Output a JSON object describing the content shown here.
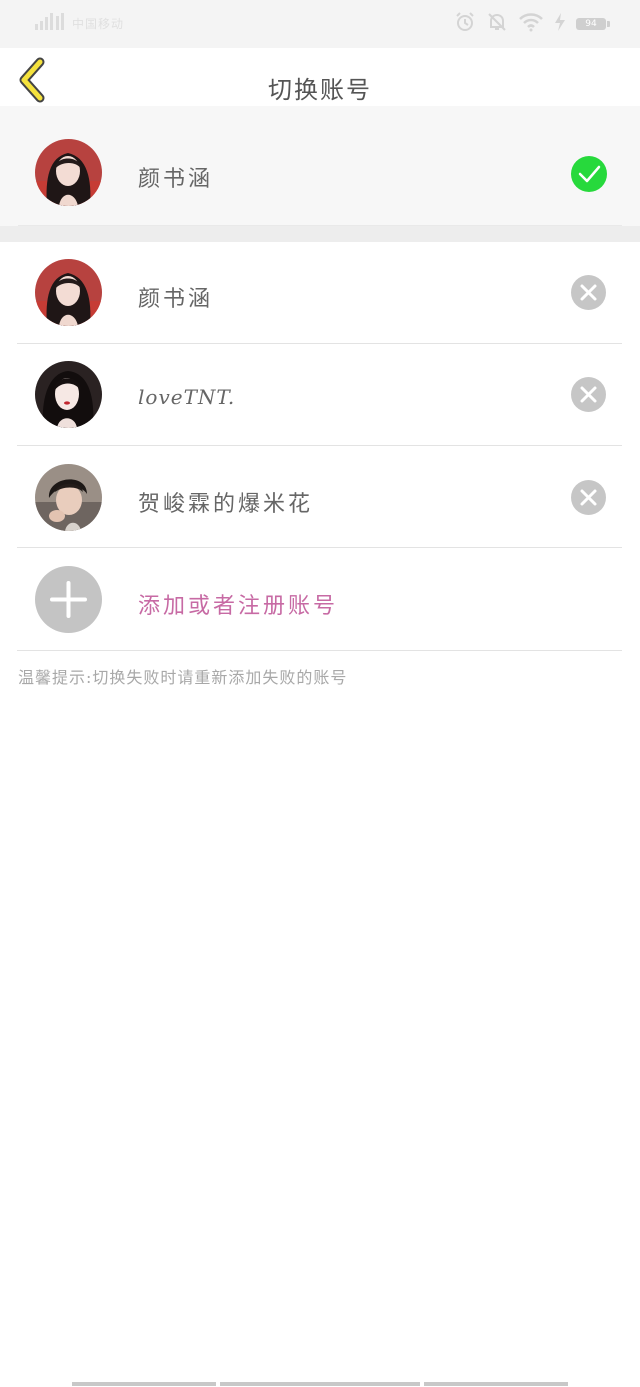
{
  "status_bar": {
    "carrier": "中国移动",
    "battery_level": "94",
    "icons": [
      "signal-icon",
      "alarm-icon",
      "mute-icon",
      "wifi-icon",
      "charging-icon",
      "battery-icon"
    ]
  },
  "header": {
    "title": "切换账号",
    "back_icon": "chevron-left-icon"
  },
  "current_account": {
    "name": "颜书涵",
    "status_icon": "check-circle-icon",
    "status_color": "#27d93c"
  },
  "accounts": [
    {
      "name": "颜书涵",
      "action_icon": "close-circle-icon"
    },
    {
      "name": "loveTNT.",
      "action_icon": "close-circle-icon"
    },
    {
      "name": "贺峻霖的爆米花",
      "action_icon": "close-circle-icon"
    }
  ],
  "add_account": {
    "label": "添加或者注册账号",
    "icon": "plus-icon",
    "label_color": "#c76aa4"
  },
  "tip": "温馨提示:切换失败时请重新添加失败的账号",
  "colors": {
    "accent_back": "#f5e23c",
    "check": "#27d93c",
    "remove": "#c6c6c6",
    "add_text": "#c76aa4"
  }
}
